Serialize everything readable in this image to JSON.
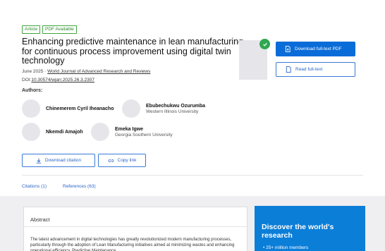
{
  "tags": {
    "article": "Article",
    "pdf": "PDF Available"
  },
  "title": "Enhancing predictive maintenance in lean manufacturing for continuous process improvement using digital twin technology",
  "meta": {
    "date": "June 2025",
    "sep": " · ",
    "journal": "World Journal of Advanced Research and Reviews",
    "doi_label": "DOI:",
    "doi": "10.30574/wjarr.2025.26.3.2307"
  },
  "authors_heading": "Authors:",
  "authors": [
    {
      "name": "Chinemerem Cyril Iheanacho",
      "affiliation": ""
    },
    {
      "name": "Ebubechukwu Ozurumba",
      "affiliation": "Western Illinois University"
    },
    {
      "name": "Nkemdi Amajoh",
      "affiliation": ""
    },
    {
      "name": "Emeka Igwe",
      "affiliation": "Georgia Southern University"
    }
  ],
  "actions": {
    "download_citation": "Download citation",
    "copy_link": "Copy link"
  },
  "tabs": {
    "citations": "Citations (1)",
    "references": "References (63)"
  },
  "sidebar": {
    "download_pdf": "Download full-text PDF",
    "read_fulltext": "Read full-text"
  },
  "abstract": {
    "heading": "Abstract",
    "text": "The latest advancement in digital technologies has greatly revolutionized modern manufacturing processes, particularly through the adoption of Lean Manufacturing initiatives aimed at minimizing wastes and enhancing operational efficiency. Predictive Maintenance"
  },
  "promo": {
    "heading": "Discover the world's research",
    "item1": "• 25+ million members"
  },
  "colors": {
    "accent": "#0a6cd8",
    "tag_green": "#2b8a2b",
    "promo_bg": "#0b7ed8"
  }
}
